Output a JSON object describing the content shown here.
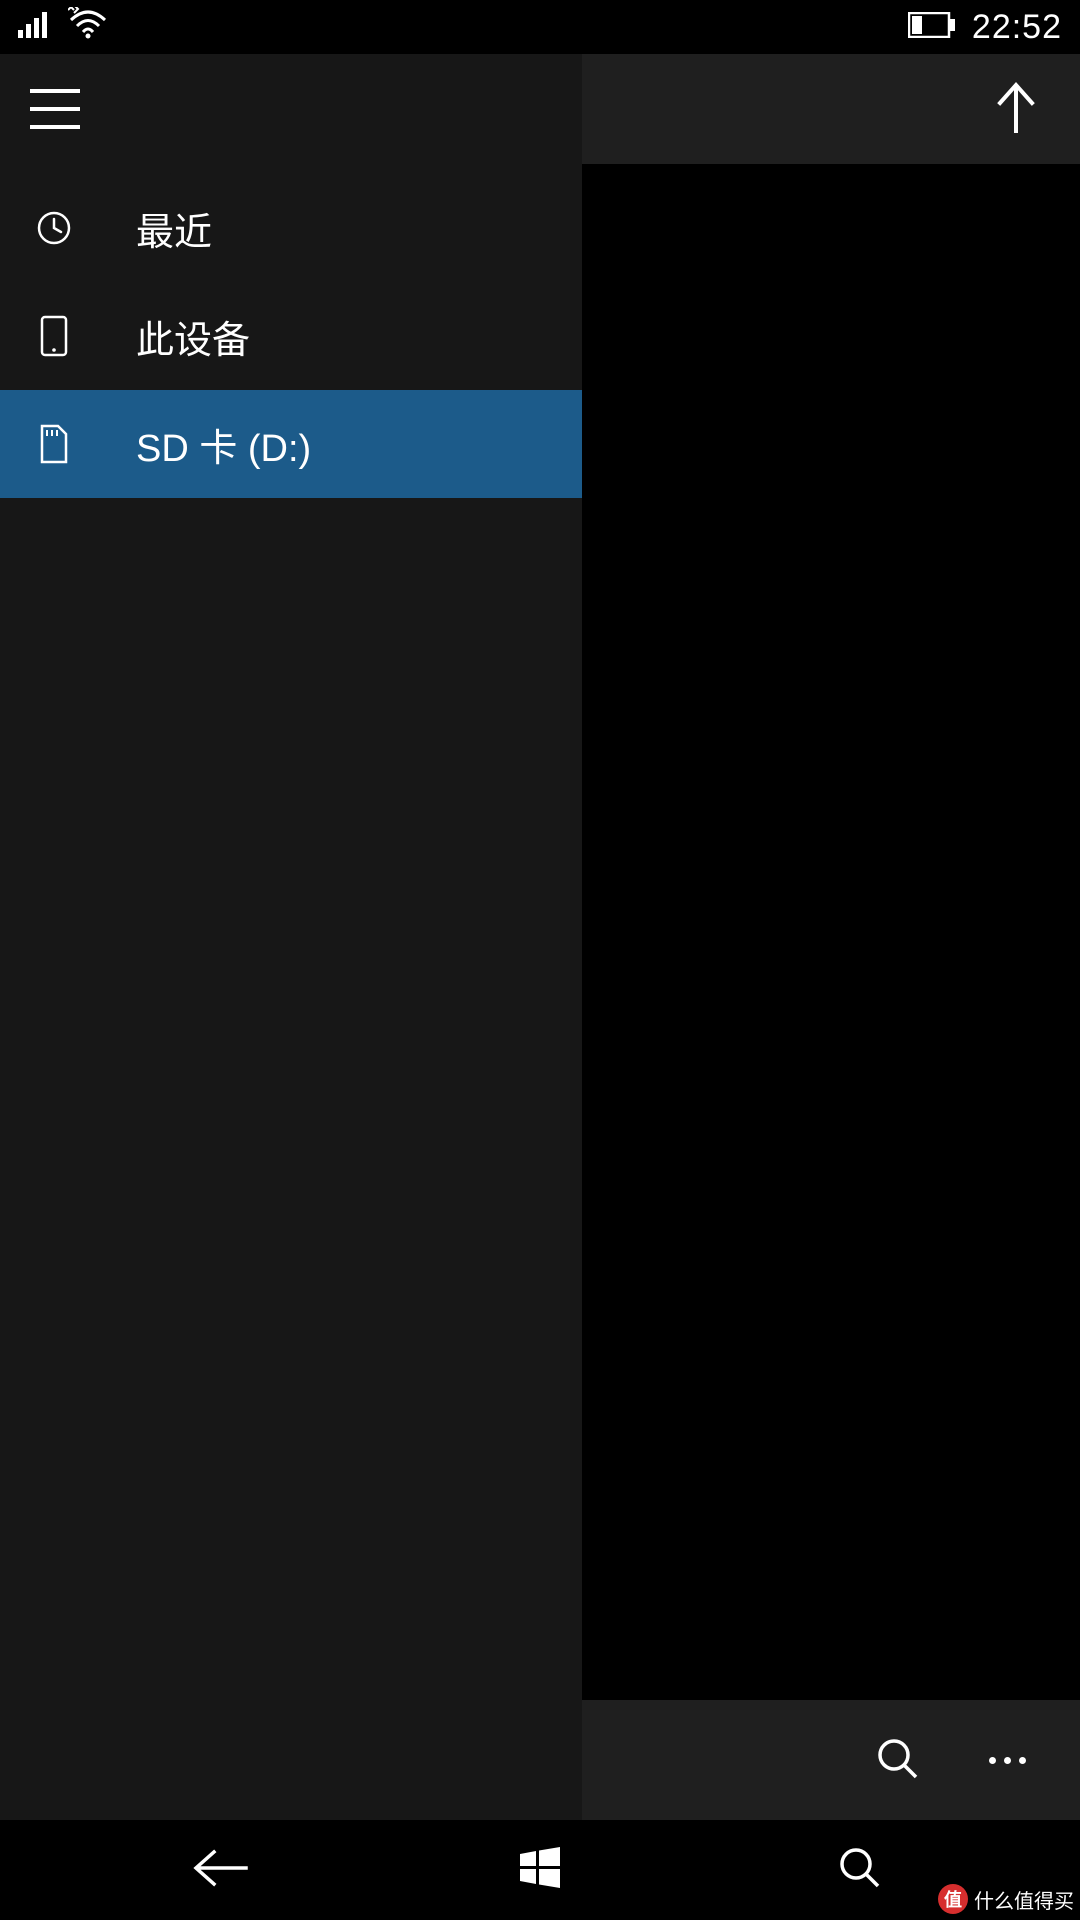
{
  "status": {
    "time": "22:52"
  },
  "drawer": {
    "items": [
      {
        "label": "最近",
        "icon": "clock-icon",
        "selected": false
      },
      {
        "label": "此设备",
        "icon": "phone-icon",
        "selected": false
      },
      {
        "label": "SD 卡 (D:)",
        "icon": "sd-card-icon",
        "selected": true
      }
    ]
  },
  "watermark": {
    "badge": "值",
    "text": "什么值得买"
  }
}
